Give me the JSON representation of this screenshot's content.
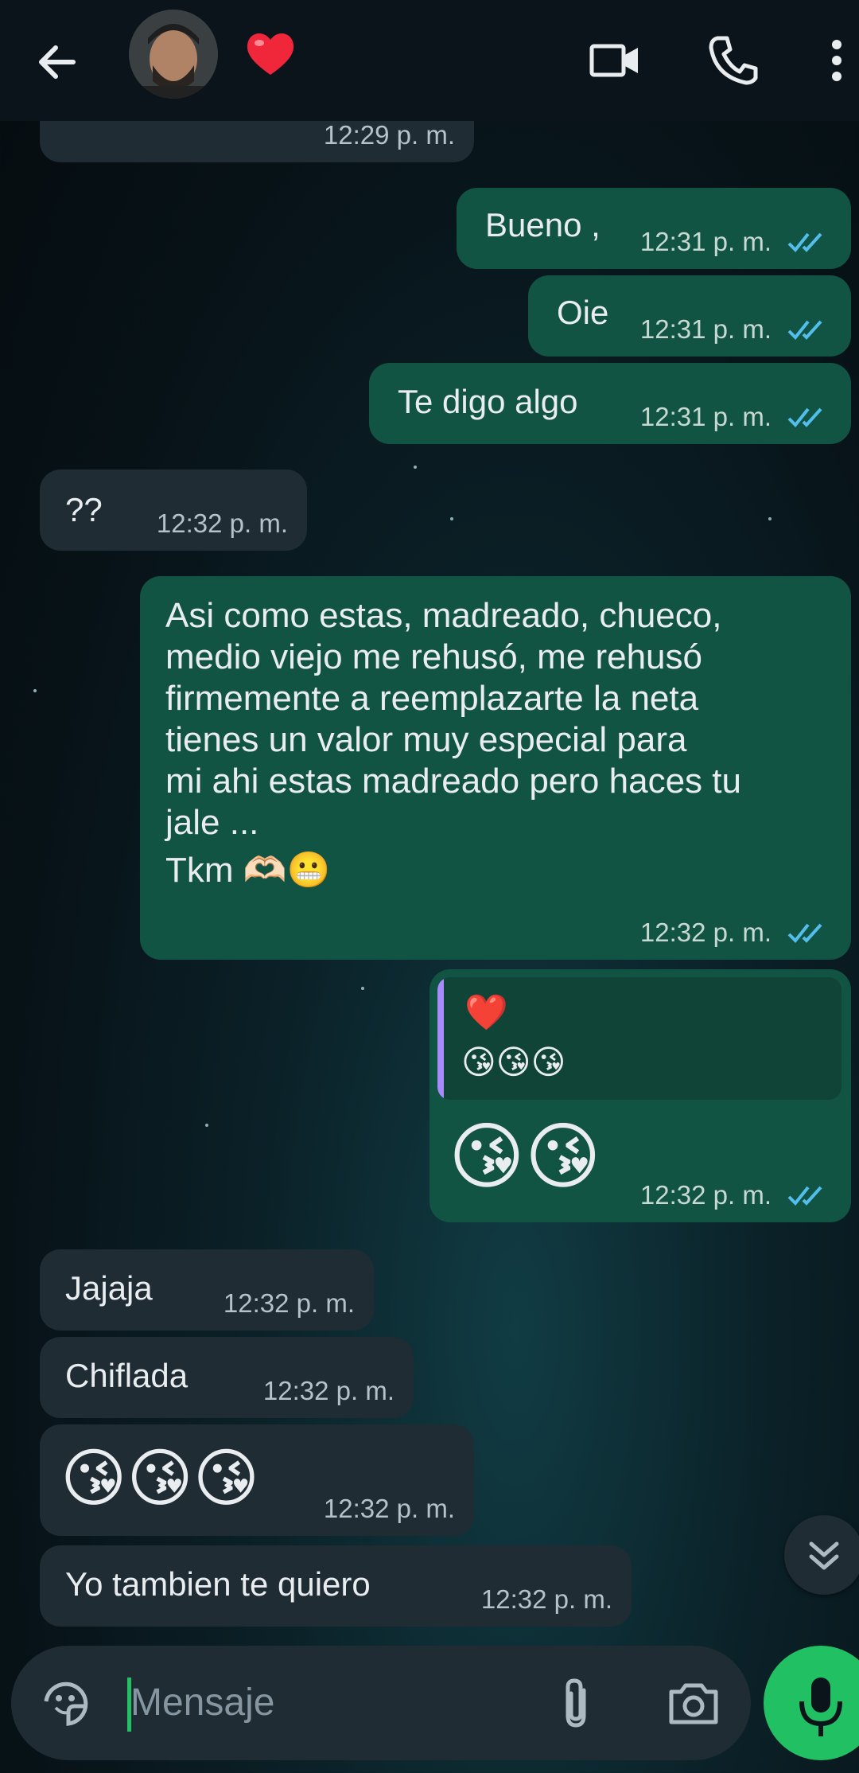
{
  "header": {
    "contact_emoji": "❤️"
  },
  "messages": [
    {
      "time": "12:29 p. m."
    },
    {
      "text": "Bueno ,",
      "time": "12:31 p. m."
    },
    {
      "text": "Oie",
      "time": "12:31 p. m."
    },
    {
      "text": "Te digo algo",
      "time": "12:31 p. m."
    },
    {
      "text": "??",
      "time": "12:32 p. m."
    },
    {
      "lines": [
        "Asi como estas, madreado, chueco,",
        "medio viejo me rehusó, me rehusó",
        "firmemente a reemplazarte la neta",
        "tienes un valor muy especial  para",
        "mi ahi estas madreado pero haces tu",
        "jale ...",
        "Tkm 🫶🏻😬"
      ],
      "time": "12:32 p. m."
    },
    {
      "quote_line1": "❤️",
      "quote_line2": "😘😘😘",
      "body": "😘😘",
      "time": "12:32 p. m."
    },
    {
      "text": "Jajaja",
      "time": "12:32 p. m."
    },
    {
      "text": "Chiflada",
      "time": "12:32 p. m."
    },
    {
      "body": "😘😘😘",
      "time": "12:32 p. m."
    },
    {
      "text": "Yo tambien te quiero",
      "time": "12:32 p. m."
    }
  ],
  "composer": {
    "placeholder": "Mensaje"
  },
  "colors": {
    "outgoing_bubble": "#125443",
    "incoming_bubble": "#1f2c34",
    "mic_button": "#21c063",
    "read_ticks": "#53bdeb"
  }
}
